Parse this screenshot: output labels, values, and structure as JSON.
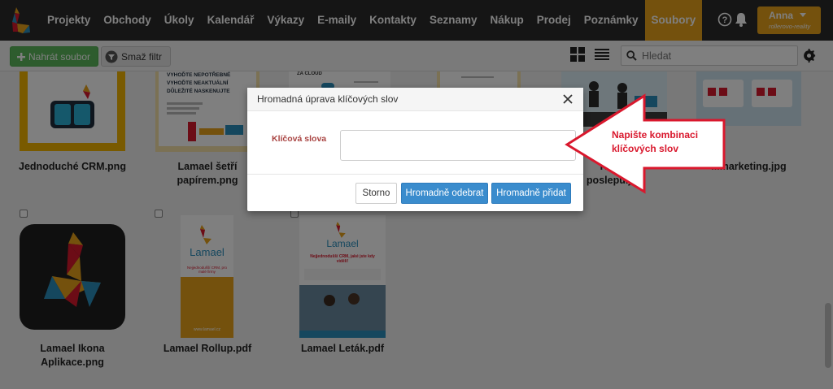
{
  "nav": {
    "items": [
      {
        "label": "Projekty"
      },
      {
        "label": "Obchody"
      },
      {
        "label": "Úkoly"
      },
      {
        "label": "Kalendář"
      },
      {
        "label": "Výkazy"
      },
      {
        "label": "E-maily"
      },
      {
        "label": "Kontakty"
      },
      {
        "label": "Seznamy"
      },
      {
        "label": "Nákup"
      },
      {
        "label": "Prodej"
      },
      {
        "label": "Poznámky"
      },
      {
        "label": "Soubory"
      }
    ],
    "active_index": 11,
    "user": {
      "name": "Anna",
      "role": "rollerovo-reality"
    }
  },
  "toolbar": {
    "upload_label": "Nahrát soubor",
    "filter_label": "Smaž filtr",
    "search_placeholder": "Hledat"
  },
  "files": {
    "row1": [
      {
        "caption": "Jednoduché CRM.png"
      },
      {
        "caption": "Lamael šetří papírem.png"
      },
      {
        "caption": ""
      },
      {
        "caption": ""
      },
      {
        "caption": "Řízení poslepu.jpg"
      },
      {
        "caption": "...marketing.jpg"
      }
    ],
    "row2": [
      {
        "caption": "Lamael Ikona Aplikace.png"
      },
      {
        "caption": "Lamael Rollup.pdf"
      },
      {
        "caption": "Lamael Leták.pdf"
      }
    ],
    "thumb_texts": {
      "papir_lines": [
        "VYHOĎTE NEPOTŘEBNÉ",
        "VYHOĎTE NEAKTUÁLNÍ",
        "DŮLEŽITÉ NASKENUJTE"
      ],
      "cloud": "ZA CLOUD",
      "brand": "Lamael",
      "rollup_tagline": "Nejjednodušší CRM, pro malé firmy",
      "rollup_url": "www.lamael.cz",
      "letak_headline": "Nejjednodušší CRM, jaké jste kdy viděli!"
    }
  },
  "modal": {
    "title": "Hromadná úprava klíčových slov",
    "keywords_label": "Klíčová slova",
    "keywords_value": "",
    "cancel_label": "Storno",
    "remove_label": "Hromadně odebrat",
    "add_label": "Hromadně přidat"
  },
  "annotation": {
    "text": "Napište kombinaci klíčových slov",
    "color": "#d9182d"
  },
  "colors": {
    "navbar": "#2b2b2b",
    "accent": "#e8a21a",
    "primary": "#3a8ccd",
    "success": "#5cb85c"
  }
}
